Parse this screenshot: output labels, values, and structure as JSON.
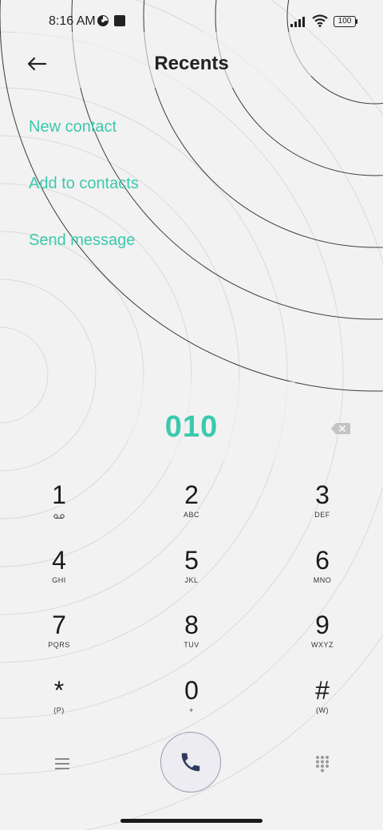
{
  "status_bar": {
    "time": "8:16 AM",
    "battery": "100"
  },
  "header": {
    "title": "Recents",
    "back_icon": "arrow-left-icon"
  },
  "actions": [
    {
      "label": "New contact"
    },
    {
      "label": "Add to contacts"
    },
    {
      "label": "Send message"
    }
  ],
  "dialer": {
    "number": "010",
    "backspace_icon": "backspace-icon",
    "keys": [
      {
        "digit": "1",
        "letters": "",
        "icon": "voicemail-icon"
      },
      {
        "digit": "2",
        "letters": "ABC"
      },
      {
        "digit": "3",
        "letters": "DEF"
      },
      {
        "digit": "4",
        "letters": "GHI"
      },
      {
        "digit": "5",
        "letters": "JKL"
      },
      {
        "digit": "6",
        "letters": "MNO"
      },
      {
        "digit": "7",
        "letters": "PQRS"
      },
      {
        "digit": "8",
        "letters": "TUV"
      },
      {
        "digit": "9",
        "letters": "WXYZ"
      },
      {
        "digit": "*",
        "letters": "(P)"
      },
      {
        "digit": "0",
        "letters": "+"
      },
      {
        "digit": "#",
        "letters": "(W)"
      }
    ]
  },
  "bottom_bar": {
    "menu_icon": "menu-icon",
    "call_icon": "phone-icon",
    "dialpad_icon": "dialpad-grid-icon"
  },
  "colors": {
    "accent": "#3cc9ac",
    "background": "#f2f2f2"
  }
}
